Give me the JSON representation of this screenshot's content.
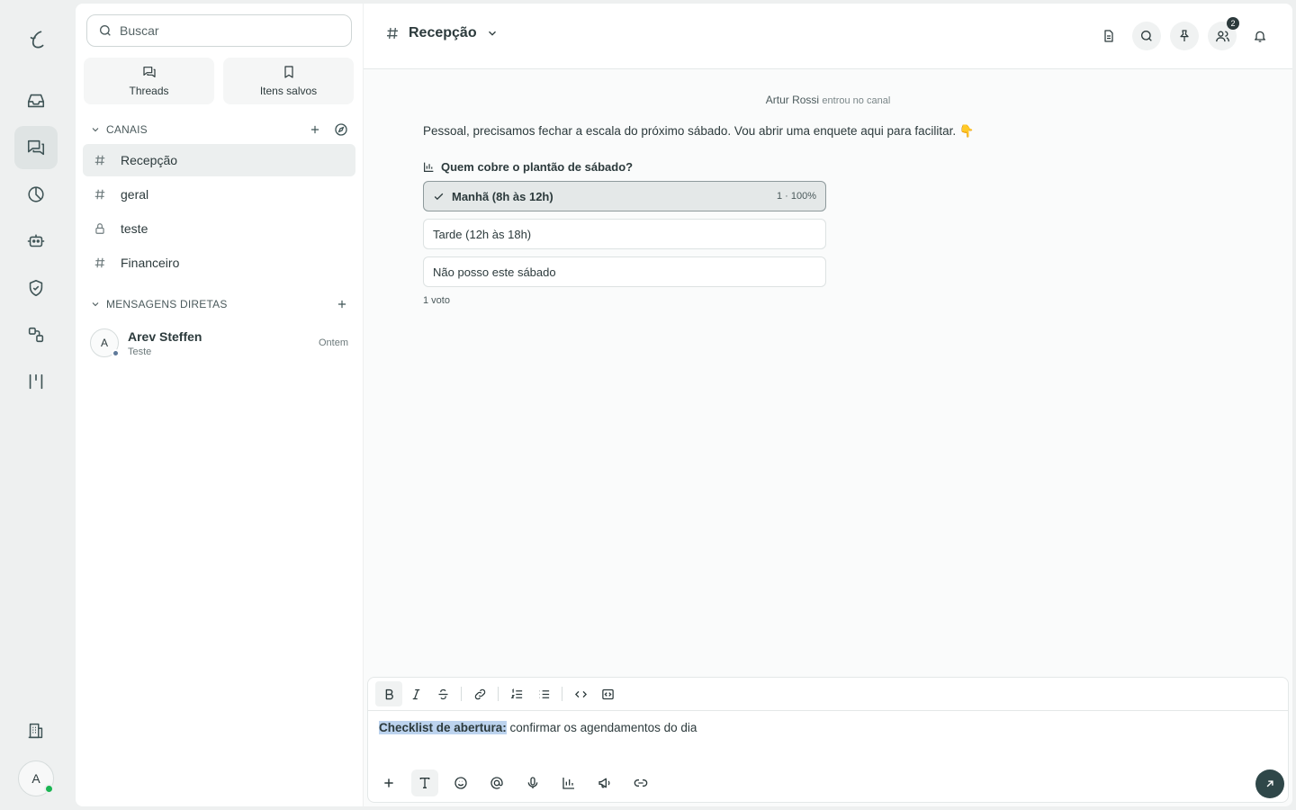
{
  "rail": {
    "items": [
      "logo-icon",
      "inbox-icon",
      "chat-icon",
      "analytics-icon",
      "bot-icon",
      "shield-icon",
      "integrations-icon",
      "kanban-icon"
    ],
    "bottom": {
      "building": "building-icon",
      "avatar_letter": "A"
    }
  },
  "sidebar": {
    "search_placeholder": "Buscar",
    "threads_label": "Threads",
    "saved_label": "Itens salvos",
    "channels_header": "CANAIS",
    "channels": [
      {
        "name": "Recepção",
        "icon": "hash-icon"
      },
      {
        "name": "geral",
        "icon": "hash-icon"
      },
      {
        "name": "teste",
        "icon": "lock-icon"
      },
      {
        "name": "Financeiro",
        "icon": "hash-icon"
      }
    ],
    "dm_header": "MENSAGENS DIRETAS",
    "dms": [
      {
        "initial": "A",
        "name": "Arev Steffen",
        "preview": "Teste",
        "time": "Ontem"
      }
    ]
  },
  "header": {
    "channel": "Recepção",
    "members_badge": "2"
  },
  "conversation": {
    "system_user": "Artur Rossi",
    "system_text": "entrou no canal",
    "message": "Pessoal, precisamos fechar a escala do próximo sábado. Vou abrir uma enquete aqui para facilitar. 👇",
    "poll": {
      "question": "Quem cobre o plantão de sábado?",
      "options": [
        {
          "label": "Manhã (8h às 12h)",
          "result": "1 · 100%",
          "selected": true
        },
        {
          "label": "Tarde (12h às 18h)",
          "result": "",
          "selected": false
        },
        {
          "label": "Não posso este sábado",
          "result": "",
          "selected": false
        }
      ],
      "votes": "1 voto"
    }
  },
  "composer": {
    "highlighted": "Checklist de abertura:",
    "text": " confirmar os agendamentos do dia"
  },
  "colors": {
    "accent": "#2f4749",
    "selection": "#bcd3ee",
    "online": "#19b552"
  }
}
